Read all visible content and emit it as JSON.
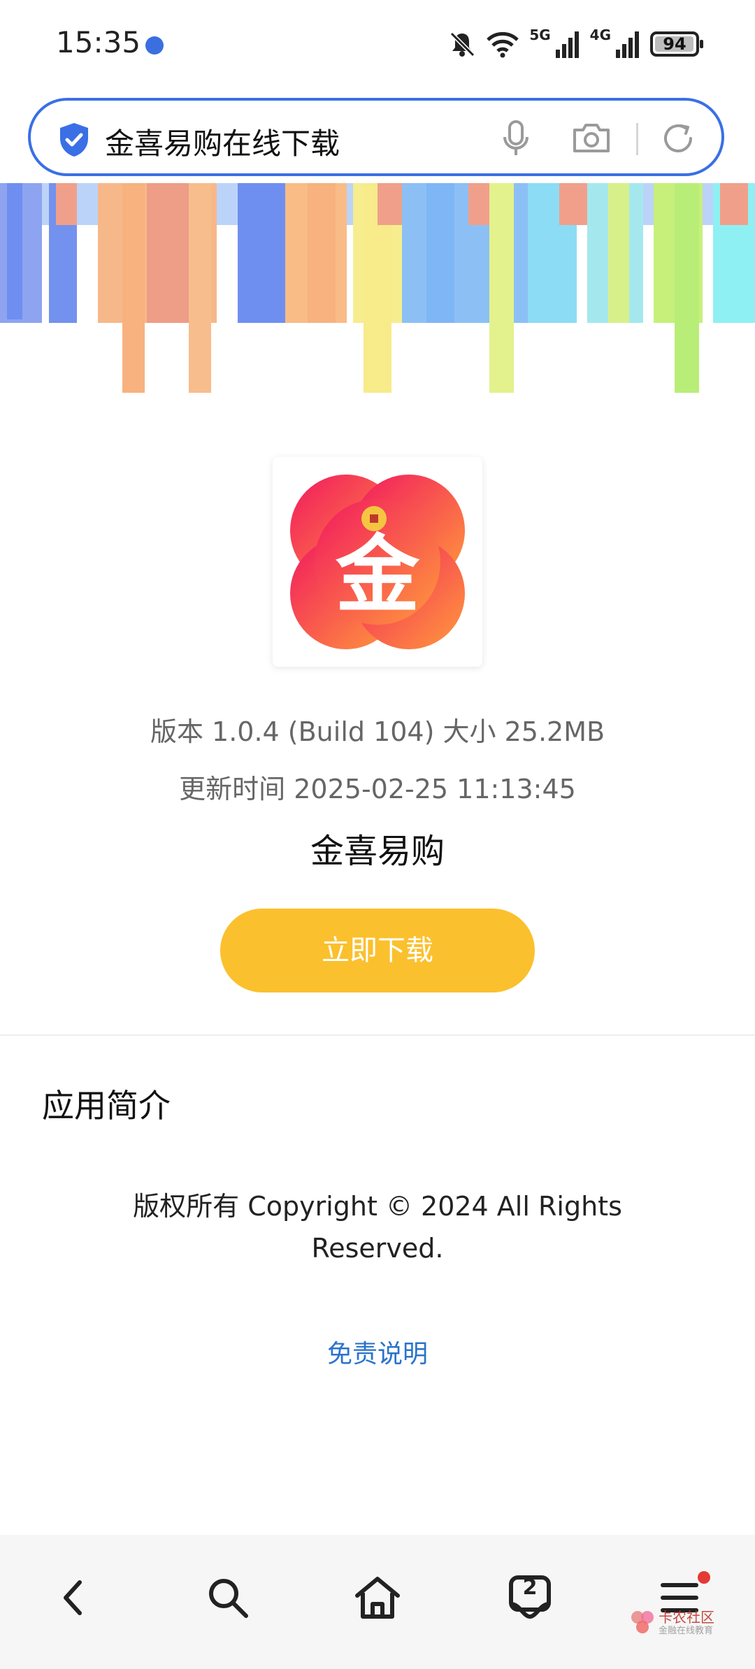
{
  "status_bar": {
    "time": "15:35",
    "signal_1_label": "5G",
    "signal_2_label": "4G",
    "battery": "94",
    "icons": [
      "bell-off-icon",
      "wifi-icon",
      "signal-icon",
      "battery-icon"
    ]
  },
  "search_bar": {
    "query": "金喜易购在线下载",
    "accent_color": "#3a6fe6"
  },
  "app": {
    "version_line": "版本 1.0.4 (Build 104) 大小 25.2MB",
    "update_line": "更新时间 2025-02-25 11:13:45",
    "name": "金喜易购",
    "icon_char": "金",
    "download_label": "立即下载",
    "download_color": "#fbc02d"
  },
  "intro": {
    "title": "应用简介",
    "copyright": "版权所有 Copyright © 2024 All Rights Reserved.",
    "disclaimer": "免责说明",
    "link_color": "#2a73cc"
  },
  "bottom_nav": {
    "tab_count": "2",
    "items": [
      "back-icon",
      "search-icon",
      "home-icon",
      "tabs-icon",
      "menu-icon"
    ]
  },
  "watermark": {
    "title": "卡农社区",
    "subtitle": "金融在线教育"
  }
}
